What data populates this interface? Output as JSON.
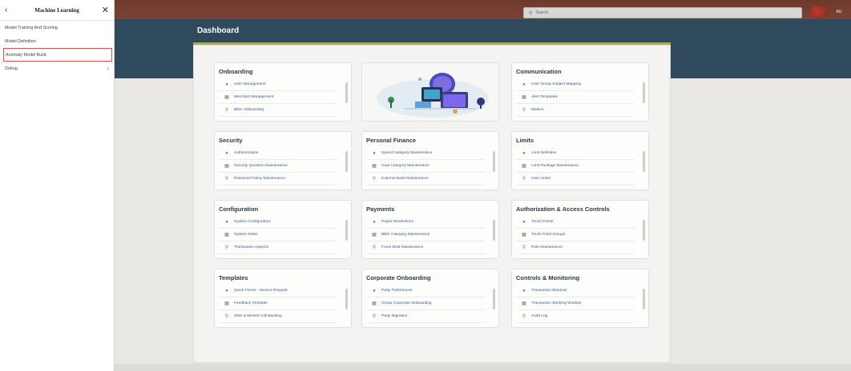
{
  "sidemenu": {
    "title": "Machine Learning",
    "back_icon": "‹",
    "close_icon": "✕",
    "items": [
      {
        "label": "Model Training And Scoring",
        "active": false
      },
      {
        "label": "Model Definition",
        "active": false
      },
      {
        "label": "Anomaly Model Build",
        "active": true
      },
      {
        "label": "Debug",
        "active": false,
        "has_children": true
      }
    ]
  },
  "topbar": {
    "search_placeholder": "Search",
    "avatar_initials": "AU"
  },
  "dashboard": {
    "title": "Dashboard",
    "accent_color": "#c8a42c",
    "band_color": "#2e4a5c",
    "topbar_color": "#7b4234",
    "cards": [
      {
        "title": "Onboarding",
        "links": [
          "User Management",
          "Merchant Management",
          "Biller Onboarding"
        ]
      },
      {
        "title": "Communication",
        "links": [
          "User Group Subject Mapping",
          "Alert Templates",
          "Mailers"
        ]
      },
      {
        "title": "Security",
        "links": [
          "Authentication",
          "Security Question Maintenance",
          "Password Policy Maintenance"
        ]
      },
      {
        "title": "Personal Finance",
        "links": [
          "Spend Category Maintenance",
          "Goal Category Maintenance",
          "External Bank Maintenance"
        ]
      },
      {
        "title": "Limits",
        "links": [
          "Limit Definition",
          "Limit Package Maintenance",
          "User Limits"
        ]
      },
      {
        "title": "Configuration",
        "links": [
          "System Configuration",
          "System Rules",
          "Transaction Aspects"
        ]
      },
      {
        "title": "Payments",
        "links": [
          "Payee Restrictions",
          "Biller Category Maintenance",
          "Forex Deal Maintenance"
        ]
      },
      {
        "title": "Authorization & Access Controls",
        "links": [
          "Touch Points",
          "Touch Point Groups",
          "Role Maintenance"
        ]
      },
      {
        "title": "Templates",
        "links": [
          "Quick Forms - Service Request",
          "Feedback Template",
          "SMS & Missed Call Banking"
        ]
      },
      {
        "title": "Corporate Onboarding",
        "links": [
          "Party Preferences",
          "Group Corporate Onboarding",
          "Party Migration"
        ]
      },
      {
        "title": "Controls & Monitoring",
        "links": [
          "Transaction Blackout",
          "Transaction Working Window",
          "Audit Log"
        ]
      }
    ]
  }
}
